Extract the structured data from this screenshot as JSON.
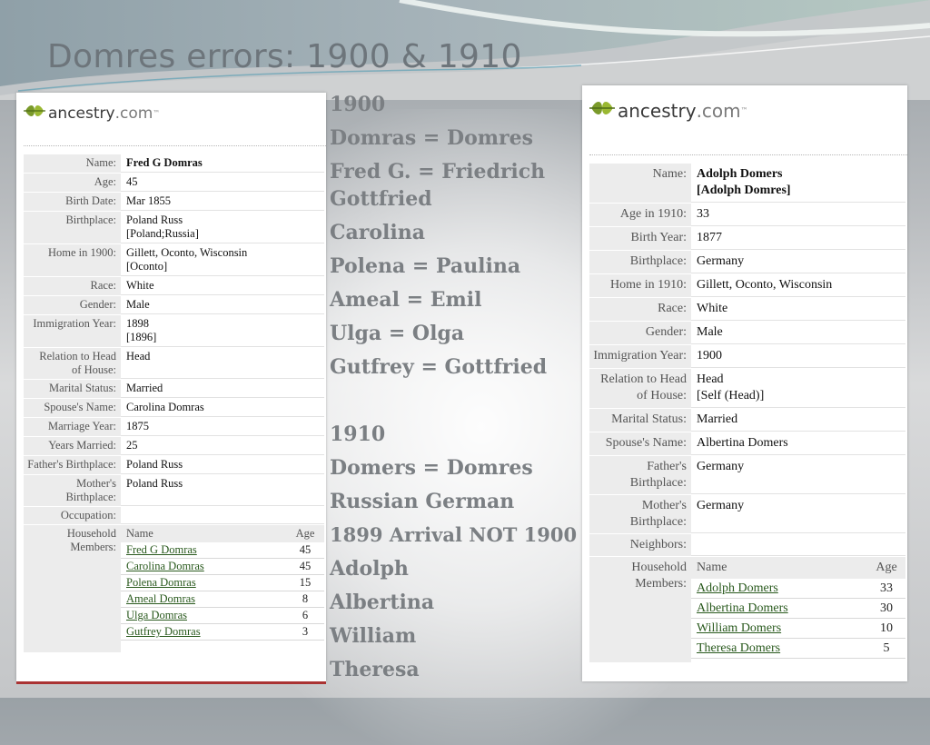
{
  "slide": {
    "title": "Domres errors: 1900 & 1910"
  },
  "notes": [
    "1900",
    "Domras = Domres",
    "Fred G. = Friedrich Gottfried",
    "Carolina",
    "Polena = Paulina",
    "Ameal = Emil",
    "Ulga = Olga",
    "Gutfrey = Gottfried",
    "",
    "1910",
    "Domers = Domres",
    "Russian German",
    "1899  Arrival NOT 1900",
    "Adolph",
    "Albertina",
    "William",
    "Theresa"
  ],
  "logo": {
    "brand": "ancestry",
    "suffix": ".com",
    "tm": "™"
  },
  "record1900": {
    "fields": [
      {
        "label": "Name:",
        "value": "Fred G Domras"
      },
      {
        "label": "Age:",
        "value": "45"
      },
      {
        "label": "Birth Date:",
        "value": "Mar 1855"
      },
      {
        "label": "Birthplace:",
        "value": "Poland Russ\n[Poland;Russia]"
      },
      {
        "label": "Home in 1900:",
        "value": "Gillett, Oconto, Wisconsin\n[Oconto]"
      },
      {
        "label": "Race:",
        "value": "White"
      },
      {
        "label": "Gender:",
        "value": "Male"
      },
      {
        "label": "Immigration Year:",
        "value": "1898\n[1896]"
      },
      {
        "label": "Relation to Head of House:",
        "value": "Head"
      },
      {
        "label": "Marital Status:",
        "value": "Married"
      },
      {
        "label": "Spouse's Name:",
        "value": "Carolina Domras"
      },
      {
        "label": "Marriage Year:",
        "value": "1875"
      },
      {
        "label": "Years Married:",
        "value": "25"
      },
      {
        "label": "Father's Birthplace:",
        "value": "Poland Russ"
      },
      {
        "label": "Mother's Birthplace:",
        "value": "Poland Russ"
      },
      {
        "label": "Occupation:",
        "value": ""
      }
    ],
    "household": {
      "label": "Household Members:",
      "col_name": "Name",
      "col_age": "Age",
      "members": [
        {
          "name": "Fred G Domras",
          "age": "45"
        },
        {
          "name": "Carolina Domras",
          "age": "45"
        },
        {
          "name": "Polena Domras",
          "age": "15"
        },
        {
          "name": "Ameal Domras",
          "age": "8"
        },
        {
          "name": "Ulga Domras",
          "age": "6"
        },
        {
          "name": "Gutfrey Domras",
          "age": "3"
        }
      ]
    }
  },
  "record1910": {
    "fields": [
      {
        "label": "Name:",
        "value": "Adolph Domers\n[Adolph Domres]"
      },
      {
        "label": "Age in 1910:",
        "value": "33"
      },
      {
        "label": "Birth Year:",
        "value": "1877"
      },
      {
        "label": "Birthplace:",
        "value": "Germany"
      },
      {
        "label": "Home in 1910:",
        "value": "Gillett, Oconto, Wisconsin"
      },
      {
        "label": "Race:",
        "value": "White"
      },
      {
        "label": "Gender:",
        "value": "Male"
      },
      {
        "label": "Immigration Year:",
        "value": "1900"
      },
      {
        "label": "Relation to Head of House:",
        "value": "Head\n[Self (Head)]"
      },
      {
        "label": "Marital Status:",
        "value": "Married"
      },
      {
        "label": "Spouse's Name:",
        "value": "Albertina Domers"
      },
      {
        "label": "Father's Birthplace:",
        "value": "Germany"
      },
      {
        "label": "Mother's Birthplace:",
        "value": "Germany"
      },
      {
        "label": "Neighbors:",
        "value": ""
      }
    ],
    "household": {
      "label": "Household Members:",
      "col_name": "Name",
      "col_age": "Age",
      "members": [
        {
          "name": "Adolph Domers",
          "age": "33"
        },
        {
          "name": "Albertina Domers",
          "age": "30"
        },
        {
          "name": "William Domers",
          "age": "10"
        },
        {
          "name": "Theresa Domers",
          "age": "5"
        }
      ]
    }
  },
  "colors": {
    "accent": "#7b7f83",
    "link": "#2a5a1e",
    "leaf": "#7a9a2a"
  }
}
